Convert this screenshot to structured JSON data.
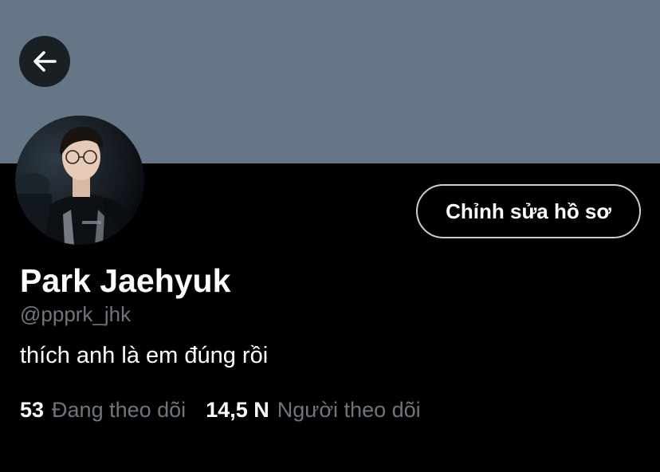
{
  "header": {
    "back_icon": "arrow-left-icon",
    "banner_color": "#657786"
  },
  "profile": {
    "name": "Park Jaehyuk",
    "handle": "@ppprk_jhk",
    "bio": "thích anh là em đúng rồi",
    "edit_button_label": "Chỉnh sửa hồ sơ"
  },
  "stats": {
    "following_count": "53",
    "following_label": "Đang theo dõi",
    "followers_count": "14,5 N",
    "followers_label": "Người theo dõi"
  },
  "colors": {
    "background": "#000000",
    "primary_text": "#ffffff",
    "secondary_text": "#6e767d",
    "button_border": "#c8d0d6"
  }
}
